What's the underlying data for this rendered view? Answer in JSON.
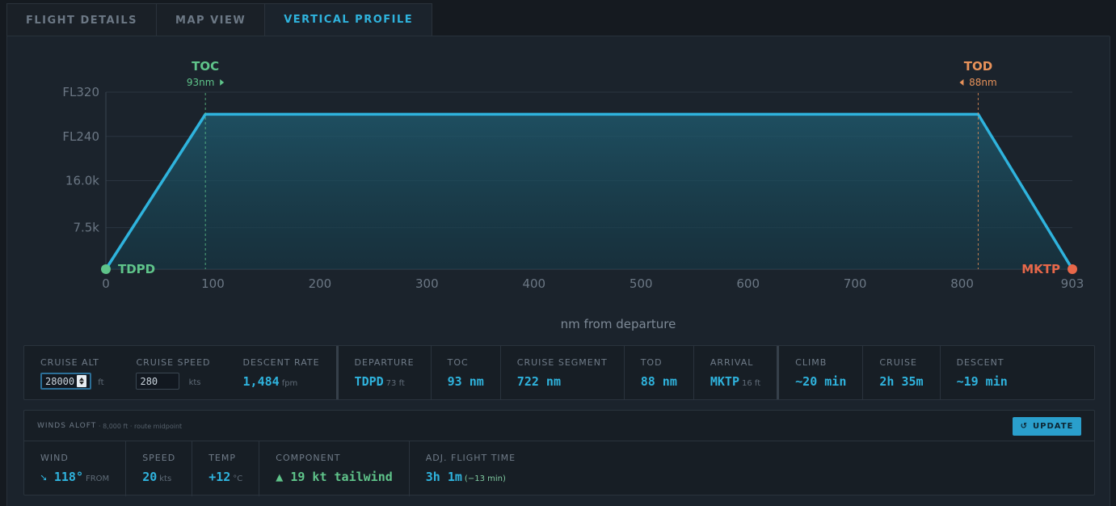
{
  "tabs": [
    {
      "label": "FLIGHT DETAILS"
    },
    {
      "label": "MAP VIEW"
    },
    {
      "label": "VERTICAL PROFILE"
    }
  ],
  "colors": {
    "accent": "#2fb3dd",
    "toc": "#5fc48a",
    "tod": "#e8925a",
    "destination": "#e8684a"
  },
  "chart_data": {
    "type": "line",
    "xlabel": "nm from departure",
    "xlim": [
      0,
      903
    ],
    "ylim": [
      0,
      32000
    ],
    "x_ticks": [
      "0",
      "100",
      "200",
      "300",
      "400",
      "500",
      "600",
      "700",
      "800",
      "903"
    ],
    "x_tick_values": [
      0,
      100,
      200,
      300,
      400,
      500,
      600,
      700,
      800,
      903
    ],
    "y_ticks": [
      {
        "label": "7.5k",
        "value": 7500
      },
      {
        "label": "16.0k",
        "value": 16000
      },
      {
        "label": "FL240",
        "value": 24000
      },
      {
        "label": "FL320",
        "value": 32000
      }
    ],
    "series": [
      {
        "x": [
          0,
          93,
          815,
          903
        ],
        "y": [
          0,
          28000,
          28000,
          0
        ]
      }
    ],
    "markers": {
      "toc": {
        "label": "TOC",
        "sub": "93nm",
        "x": 93
      },
      "tod": {
        "label": "TOD",
        "sub": "88nm",
        "x": 815
      },
      "origin": {
        "label": "TDPD",
        "x": 0
      },
      "destination": {
        "label": "MKTP",
        "x": 903
      }
    }
  },
  "stats": {
    "cruise_alt": {
      "label": "CRUISE ALT",
      "value": "28000",
      "unit": "ft"
    },
    "cruise_speed": {
      "label": "CRUISE SPEED",
      "value": "280",
      "unit": "kts"
    },
    "descent_rate": {
      "label": "DESCENT RATE",
      "value": "1,484",
      "unit": "fpm"
    },
    "departure": {
      "label": "DEPARTURE",
      "value": "TDPD",
      "unit": "73 ft"
    },
    "toc": {
      "label": "TOC",
      "value": "93 nm"
    },
    "cruise_segment": {
      "label": "CRUISE SEGMENT",
      "value": "722 nm"
    },
    "tod": {
      "label": "TOD",
      "value": "88 nm"
    },
    "arrival": {
      "label": "ARRIVAL",
      "value": "MKTP",
      "unit": "16 ft"
    },
    "climb": {
      "label": "CLIMB",
      "value": "~20 min"
    },
    "cruise": {
      "label": "CRUISE",
      "value": "2h 35m"
    },
    "descent": {
      "label": "DESCENT",
      "value": "~19 min"
    }
  },
  "winds": {
    "title": "WINDS ALOFT",
    "subtitle": "· 8,000 ft · route midpoint",
    "update_label": "UPDATE",
    "wind": {
      "label": "WIND",
      "value": "118°",
      "unit": "FROM"
    },
    "speed": {
      "label": "SPEED",
      "value": "20",
      "unit": "kts"
    },
    "temp": {
      "label": "TEMP",
      "value": "+12",
      "unit": "°C"
    },
    "component": {
      "label": "COMPONENT",
      "value": "▲ 19 kt tailwind"
    },
    "adj_time": {
      "label": "ADJ. FLIGHT TIME",
      "value": "3h 1m",
      "note": "(−13 min)"
    }
  }
}
